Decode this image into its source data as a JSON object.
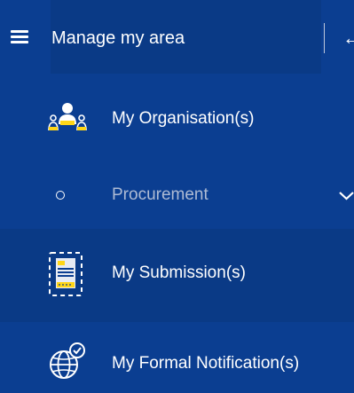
{
  "header": {
    "title": "Manage my area",
    "menu_icon": "hamburger-menu-icon",
    "collapse_icon": "arrow-left-icon",
    "collapse_glyph": "←"
  },
  "menu": {
    "items": [
      {
        "label": "My Organisation(s)",
        "icon": "organisation-icon"
      },
      {
        "label": "Procurement",
        "icon": "radio-circle-icon",
        "expand_icon": "chevron-down-icon",
        "muted": true
      },
      {
        "label": "My Submission(s)",
        "icon": "submission-document-icon",
        "highlighted": true
      },
      {
        "label": "My Formal Notification(s)",
        "icon": "globe-notification-icon"
      }
    ]
  },
  "colors": {
    "background": "#0b3e91",
    "panel": "#0a3a86",
    "text": "#ffffff",
    "muted_text": "#aebbd4",
    "accent": "#ffd617"
  }
}
